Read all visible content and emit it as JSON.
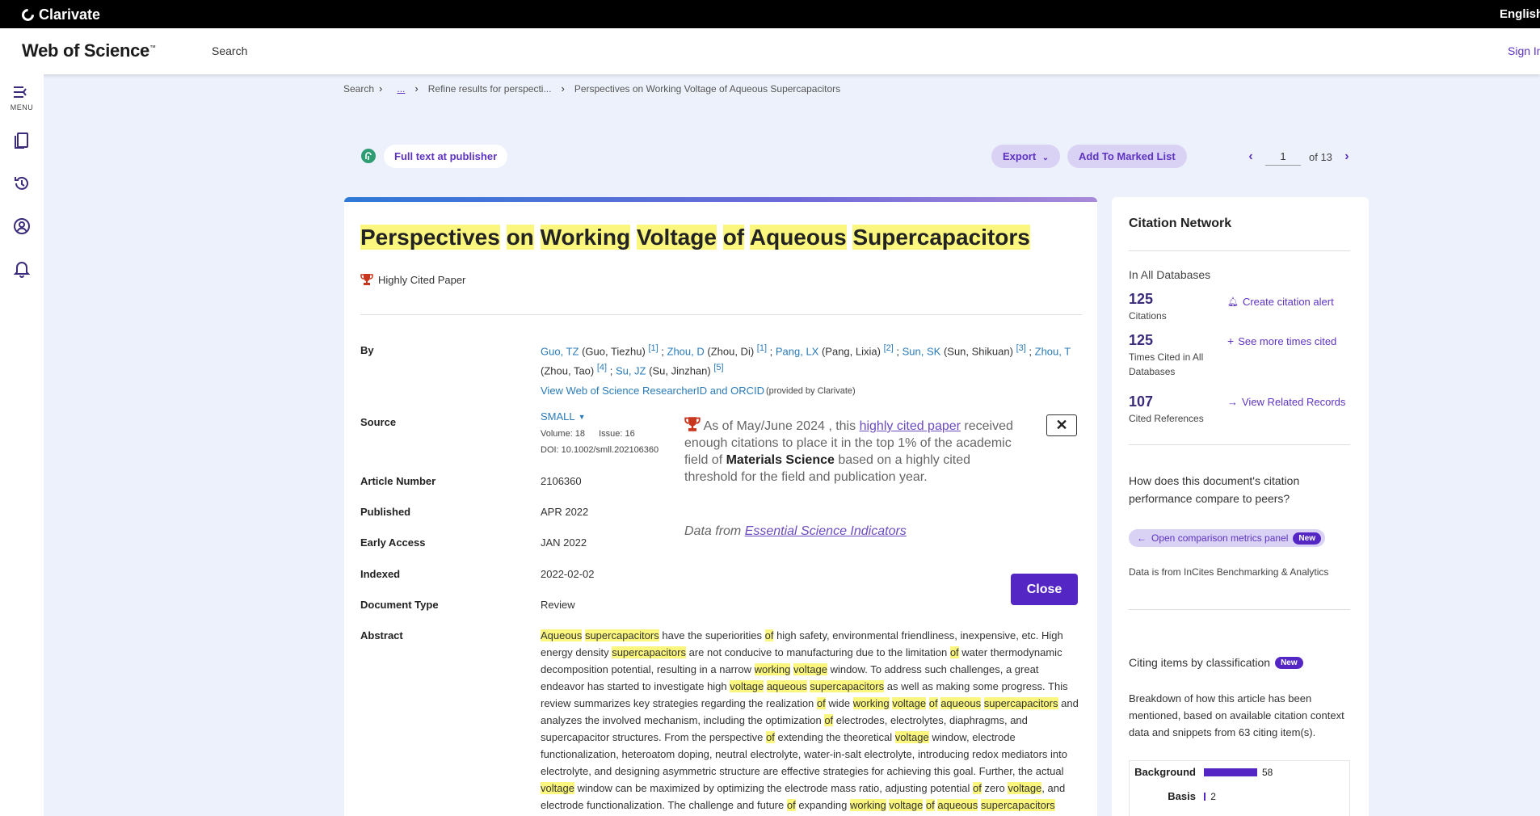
{
  "brand": {
    "clarivate": "Clarivate",
    "wos": "Web of Science",
    "wos_tm": "™"
  },
  "header": {
    "nav_search": "Search",
    "language": "English",
    "sign_in": "Sign In"
  },
  "rail": {
    "menu_label": "MENU"
  },
  "breadcrumb": [
    {
      "label": "Search"
    },
    {
      "label": "..."
    },
    {
      "label": "Refine results for perspecti..."
    },
    {
      "label": "Perspectives on Working Voltage of Aqueous Supercapacitors"
    }
  ],
  "actions": {
    "full_text": "Full text at publisher",
    "export": "Export",
    "add_marked": "Add To Marked List",
    "page_current": "1",
    "page_of": "of 13"
  },
  "record": {
    "title_words": [
      "Perspectives",
      "on",
      "Working",
      "Voltage",
      "of",
      "Aqueous",
      "Supercapacitors"
    ],
    "highly_cited": "Highly Cited Paper",
    "labels": {
      "by": "By",
      "source": "Source",
      "article_number": "Article Number",
      "published": "Published",
      "early_access": "Early Access",
      "indexed": "Indexed",
      "document_type": "Document Type",
      "abstract": "Abstract"
    },
    "authors": [
      {
        "short": "Guo, TZ",
        "full": "(Guo, Tiezhu)",
        "ref": "[1]"
      },
      {
        "short": "Zhou, D",
        "full": "(Zhou, Di)",
        "ref": "[1]"
      },
      {
        "short": "Pang, LX",
        "full": "(Pang, Lixia)",
        "ref": "[2]"
      },
      {
        "short": "Sun, SK",
        "full": "(Sun, Shikuan)",
        "ref": "[3]"
      },
      {
        "short": "Zhou, T",
        "full": "(Zhou, Tao)",
        "ref": "[4]"
      },
      {
        "short": "Su, JZ",
        "full": "(Su, Jinzhan)",
        "ref": "[5]"
      }
    ],
    "researcher_link": "View Web of Science ResearcherID and ORCID",
    "researcher_note": "(provided by Clarivate)",
    "journal": "SMALL",
    "volume": "Volume: 18",
    "issue": "Issue: 16",
    "doi": "DOI: 10.1002/smll.202106360",
    "article_number": "2106360",
    "published": "APR 2022",
    "early_access": "JAN 2022",
    "indexed": "2022-02-02",
    "document_type": "Review",
    "abstract": "Aqueous supercapacitors have the superiorities of high safety, environmental friendliness, inexpensive, etc. High energy density supercapacitors are not conducive to manufacturing due to the limitation of water thermodynamic decomposition potential, resulting in a narrow working voltage window. To address such challenges, a great endeavor has started to investigate high voltage aqueous supercapacitors as well as making some progress. This review summarizes key strategies regarding the realization of wide working voltage of aqueous supercapacitors and analyzes the involved mechanism, including the optimization of electrodes, electrolytes, diaphragms, and supercapacitor structures. From the perspective of extending the theoretical voltage window, electrode functionalization, heteroatom doping, neutral electrolyte, water-in-salt electrolyte, introducing redox mediators into electrolyte, and designing asymmetric structure are effective strategies for achieving this goal. Further, the actual voltage window can be maximized by optimizing the electrode mass ratio, adjusting potential of zero voltage, and electrode functionalization. The challenge and future of expanding working voltage of aqueous supercapacitors",
    "abstract_highlight_terms": [
      "Aqueous",
      "aqueous",
      "supercapacitors",
      "of",
      "working",
      "voltage"
    ]
  },
  "popup": {
    "text_pre": "As of May/June 2024 , this ",
    "hcp_link": "highly cited paper",
    "text_mid": " received enough citations to place it in the top 1% of the academic field of ",
    "field": "Materials Science",
    "text_post": " based on a highly cited threshold for the field and publication year.",
    "source_pre": "Data from ",
    "source_link": "Essential Science Indicators",
    "close_x": "✕",
    "close_label": "Close"
  },
  "sidebar": {
    "title": "Citation Network",
    "all_databases": "In All Databases",
    "citations_num": "125",
    "citations_lbl": "Citations",
    "times_cited_num": "125",
    "times_cited_lbl": "Times Cited in All Databases",
    "cited_refs_num": "107",
    "cited_refs_lbl": "Cited References",
    "create_alert": "Create citation alert",
    "see_more": "See more times cited",
    "view_related": "View Related Records",
    "compare_q": "How does this document's citation performance compare to peers?",
    "compare_btn": "Open comparison metrics panel",
    "new_badge": "New",
    "incites_note": "Data is from InCites Benchmarking & Analytics",
    "citing_title": "Citing items by classification",
    "citing_desc": "Breakdown of how this article has been mentioned, based on available citation context data and snippets from 63 citing item(s).",
    "classification": [
      {
        "label": "Background",
        "value": 58
      },
      {
        "label": "Basis",
        "value": 2
      }
    ]
  },
  "colors": {
    "accent": "#5427c4",
    "link": "#2a7ab8",
    "highlight": "#fbf77e",
    "page_bg": "#edf1fb"
  }
}
